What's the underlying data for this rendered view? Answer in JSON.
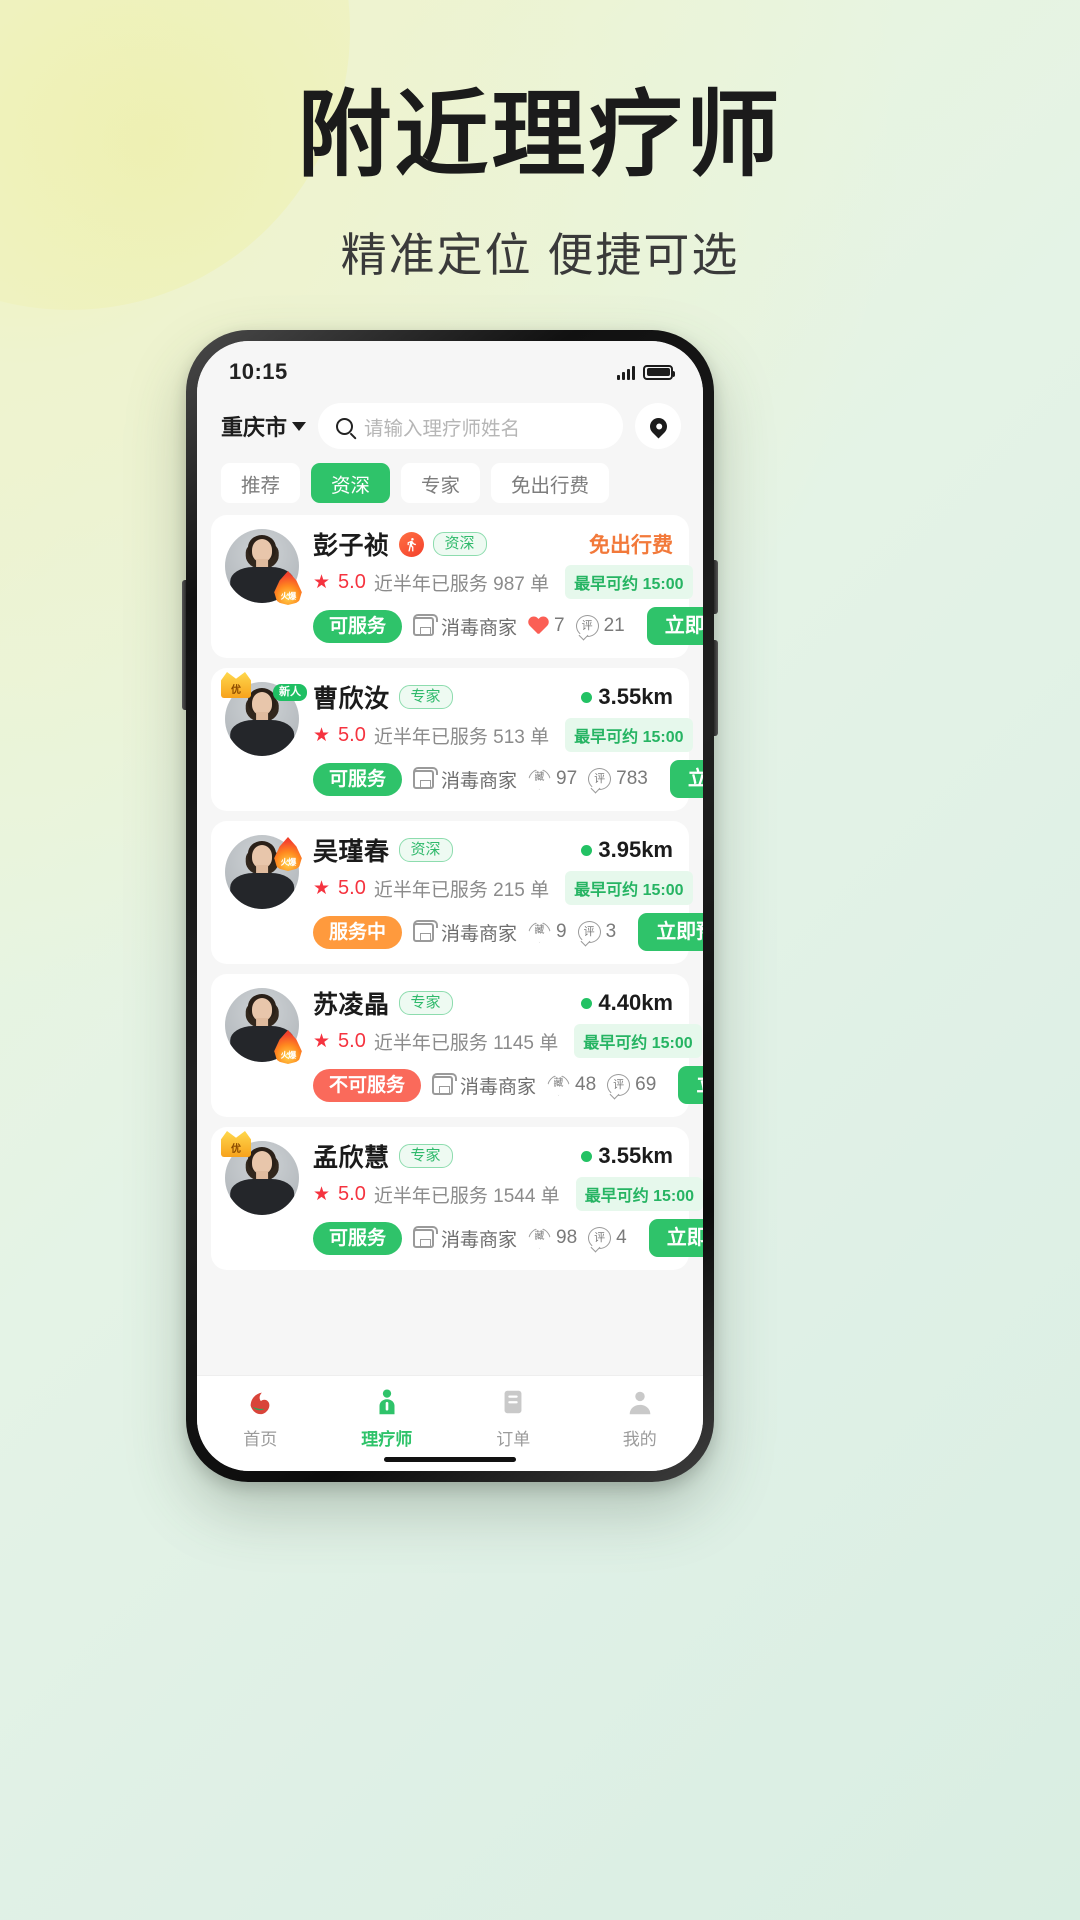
{
  "hero": {
    "title": "附近理疗师",
    "subtitle": "精准定位  便捷可选"
  },
  "statusbar": {
    "time": "10:15"
  },
  "search": {
    "city": "重庆市",
    "placeholder": "请输入理疗师姓名",
    "search_icon": "search-icon",
    "location_icon": "map-pin-icon"
  },
  "filters": [
    {
      "label": "推荐",
      "active": false
    },
    {
      "label": "资深",
      "active": true
    },
    {
      "label": "专家",
      "active": false
    },
    {
      "label": "免出行费",
      "active": false
    }
  ],
  "colors": {
    "accent_green": "#2fc36a",
    "badge_green_bg": "#e6f8ec",
    "orange": "#f2793a",
    "red": "#f5333f",
    "busy_orange": "#ff9a3d",
    "unavailable_red": "#fa6a5b"
  },
  "therapists": [
    {
      "name": "彭子祯",
      "level_tag": "资深",
      "has_run_icon": true,
      "corner_badge": "火爆",
      "corner_badge_type": "flame",
      "right_label": "免出行费",
      "right_label_type": "free-trip",
      "rating": "5.0",
      "served_text": "近半年已服务 987 单",
      "earliest": "最早可约 15:00",
      "status": "可服务",
      "status_type": "ok",
      "shop_label": "消毒商家",
      "like_count": "7",
      "like_type": "heart-filled",
      "comment_count": "21",
      "book_label": "立即预约"
    },
    {
      "name": "曹欣汝",
      "level_tag": "专家",
      "has_run_icon": false,
      "corner_badge": "优",
      "corner_badge_type": "crown",
      "new_badge": "新人",
      "right_label": "3.55km",
      "right_label_type": "distance",
      "rating": "5.0",
      "served_text": "近半年已服务 513 单",
      "earliest": "最早可约 15:00",
      "status": "可服务",
      "status_type": "ok",
      "shop_label": "消毒商家",
      "like_count": "97",
      "like_type": "heart-outline",
      "comment_count": "783",
      "book_label": "立即预约"
    },
    {
      "name": "吴瑾春",
      "level_tag": "资深",
      "has_run_icon": false,
      "corner_badge": "火爆",
      "corner_badge_type": "flame",
      "right_label": "3.95km",
      "right_label_type": "distance",
      "rating": "5.0",
      "served_text": "近半年已服务 215 单",
      "earliest": "最早可约 15:00",
      "status": "服务中",
      "status_type": "busy",
      "shop_label": "消毒商家",
      "like_count": "9",
      "like_type": "heart-outline",
      "comment_count": "3",
      "book_label": "立即预约"
    },
    {
      "name": "苏凌晶",
      "level_tag": "专家",
      "has_run_icon": false,
      "corner_badge": "火爆",
      "corner_badge_type": "flame",
      "right_label": "4.40km",
      "right_label_type": "distance",
      "rating": "5.0",
      "served_text": "近半年已服务 1145 单",
      "earliest": "最早可约 15:00",
      "status": "不可服务",
      "status_type": "no",
      "shop_label": "消毒商家",
      "like_count": "48",
      "like_type": "heart-outline",
      "comment_count": "69",
      "book_label": "立即预约"
    },
    {
      "name": "孟欣慧",
      "level_tag": "专家",
      "has_run_icon": false,
      "corner_badge": "优",
      "corner_badge_type": "crown",
      "right_label": "3.55km",
      "right_label_type": "distance",
      "rating": "5.0",
      "served_text": "近半年已服务 1544 单",
      "earliest": "最早可约 15:00",
      "status": "可服务",
      "status_type": "ok",
      "shop_label": "消毒商家",
      "like_count": "98",
      "like_type": "heart-outline",
      "comment_count": "4",
      "book_label": "立即预约"
    }
  ],
  "tabbar": [
    {
      "label": "首页",
      "icon": "home-icon",
      "active": false
    },
    {
      "label": "理疗师",
      "icon": "therapist-icon",
      "active": true
    },
    {
      "label": "订单",
      "icon": "order-icon",
      "active": false
    },
    {
      "label": "我的",
      "icon": "profile-icon",
      "active": false
    }
  ]
}
